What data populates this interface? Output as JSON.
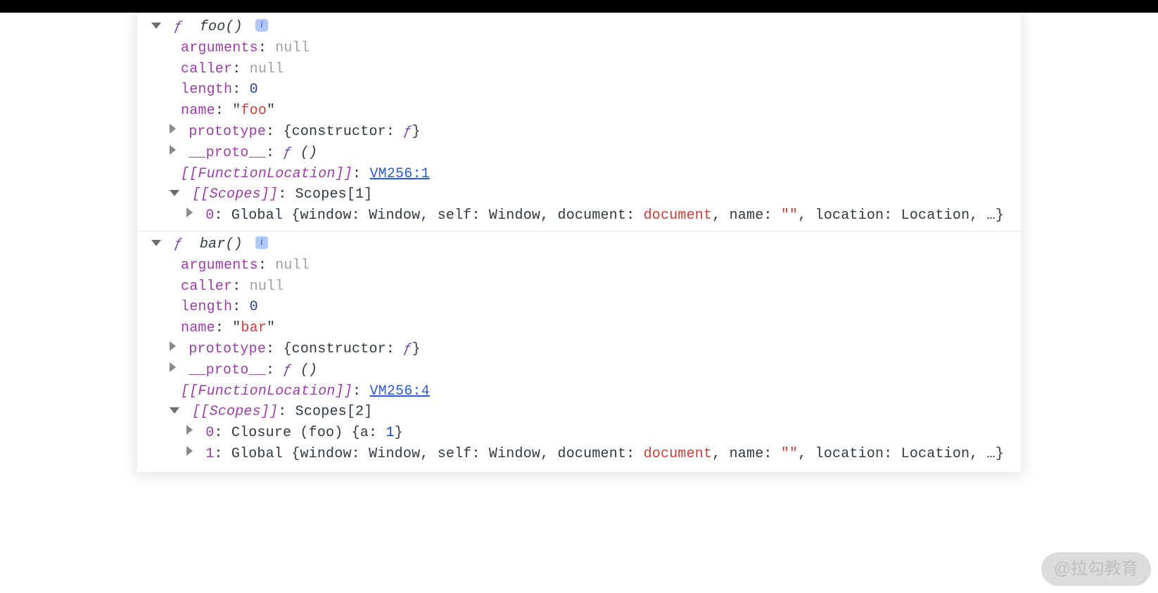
{
  "watermark": "@拉勾教育",
  "fglyph": "ƒ",
  "info_glyph": "i",
  "foo": {
    "signature": "foo()",
    "arguments": {
      "label": "arguments",
      "value": "null"
    },
    "caller": {
      "label": "caller",
      "value": "null"
    },
    "length": {
      "label": "length",
      "value": "0"
    },
    "name_prop": {
      "label": "name",
      "quote": "\"",
      "value": "foo"
    },
    "prototype": {
      "label": "prototype",
      "open": "{",
      "constructor_label": "constructor: ",
      "constructor_val": "ƒ",
      "close": "}"
    },
    "proto": {
      "label": "__proto__",
      "value_prefix": "ƒ ",
      "value_suffix": "()"
    },
    "funcloc": {
      "label": "[[FunctionLocation]]",
      "link": "VM256:1"
    },
    "scopes": {
      "label": "[[Scopes]]",
      "value": "Scopes[1]"
    },
    "scope0": {
      "idx": "0",
      "name": "Global ",
      "open": "{",
      "p1k": "window: ",
      "p1v": "Window",
      "p2k": "self: ",
      "p2v": "Window",
      "p3k": "document: ",
      "p3v": "document",
      "p4k": "name: ",
      "p4v": "\"\"",
      "p5k": "location: ",
      "p5v": "Location",
      "tail": ", …}",
      "sep": ", "
    }
  },
  "bar": {
    "signature": "bar()",
    "arguments": {
      "label": "arguments",
      "value": "null"
    },
    "caller": {
      "label": "caller",
      "value": "null"
    },
    "length": {
      "label": "length",
      "value": "0"
    },
    "name_prop": {
      "label": "name",
      "quote": "\"",
      "value": "bar"
    },
    "prototype": {
      "label": "prototype",
      "open": "{",
      "constructor_label": "constructor: ",
      "constructor_val": "ƒ",
      "close": "}"
    },
    "proto": {
      "label": "__proto__",
      "value_prefix": "ƒ ",
      "value_suffix": "()"
    },
    "funcloc": {
      "label": "[[FunctionLocation]]",
      "link": "VM256:4"
    },
    "scopes": {
      "label": "[[Scopes]]",
      "value": "Scopes[2]"
    },
    "scope0": {
      "idx": "0",
      "prefix": "Closure (foo) ",
      "open": "{",
      "a_k": "a: ",
      "a_v": "1",
      "close": "}"
    },
    "scope1": {
      "idx": "1",
      "name": "Global ",
      "open": "{",
      "p1k": "window: ",
      "p1v": "Window",
      "p2k": "self: ",
      "p2v": "Window",
      "p3k": "document: ",
      "p3v": "document",
      "p4k": "name: ",
      "p4v": "\"\"",
      "p5k": "location: ",
      "p5v": "Location",
      "tail": ", …}",
      "sep": ", "
    }
  }
}
